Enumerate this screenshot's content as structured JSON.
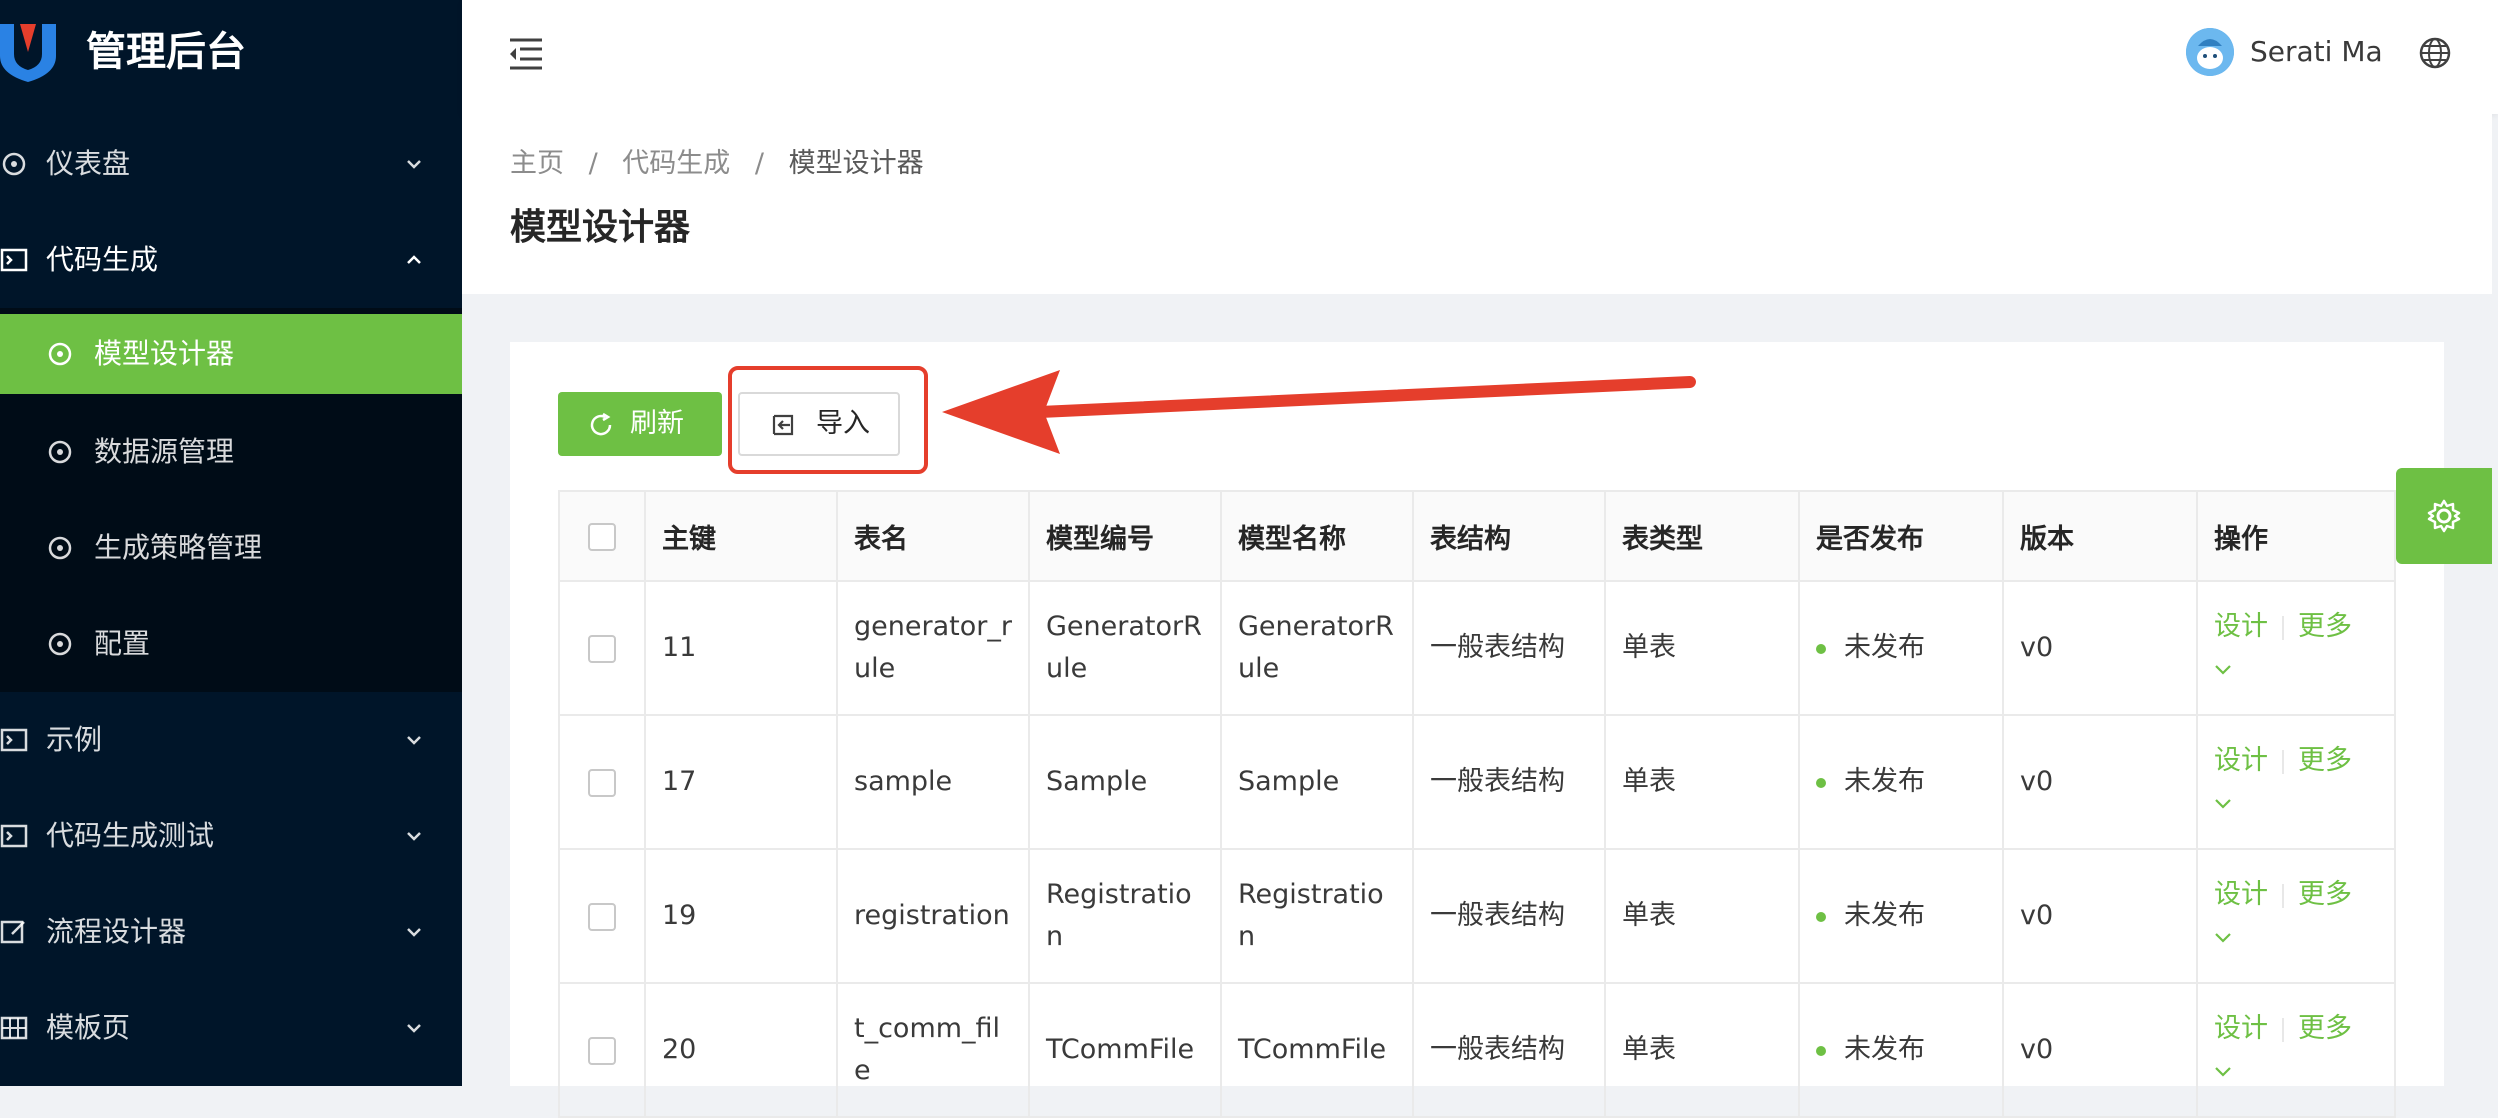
{
  "app": {
    "title": "管理后台"
  },
  "sidebar": {
    "items": [
      {
        "label": "仪表盘"
      },
      {
        "label": "代码生成"
      },
      {
        "label": "示例"
      },
      {
        "label": "代码生成测试"
      },
      {
        "label": "流程设计器"
      },
      {
        "label": "模板页"
      }
    ],
    "submenu": [
      {
        "label": "模型设计器",
        "active": true
      },
      {
        "label": "数据源管理"
      },
      {
        "label": "生成策略管理"
      },
      {
        "label": "配置"
      }
    ]
  },
  "header": {
    "username": "Serati Ma"
  },
  "breadcrumb": {
    "home": "主页",
    "parent": "代码生成",
    "current": "模型设计器",
    "separator": "/"
  },
  "page": {
    "title": "模型设计器"
  },
  "toolbar": {
    "refresh_label": "刷新",
    "import_label": "导入"
  },
  "table": {
    "columns": [
      "主键",
      "表名",
      "模型编号",
      "模型名称",
      "表结构",
      "表类型",
      "是否发布",
      "版本",
      "操作"
    ],
    "rows": [
      {
        "id": "11",
        "table_name": "generator_rule",
        "model_code": "GeneratorRule",
        "model_name": "GeneratorRule",
        "structure": "一般表结构",
        "type": "单表",
        "status": "未发布",
        "version": "v0"
      },
      {
        "id": "17",
        "table_name": "sample",
        "model_code": "Sample",
        "model_name": "Sample",
        "structure": "一般表结构",
        "type": "单表",
        "status": "未发布",
        "version": "v0"
      },
      {
        "id": "19",
        "table_name": "registration",
        "model_code": "Registration",
        "model_name": "Registration",
        "structure": "一般表结构",
        "type": "单表",
        "status": "未发布",
        "version": "v0"
      },
      {
        "id": "20",
        "table_name": "t_comm_file",
        "model_code": "TCommFile",
        "model_name": "TCommFile",
        "structure": "一般表结构",
        "type": "单表",
        "status": "未发布",
        "version": "v0"
      }
    ],
    "actions": {
      "design": "设计",
      "more": "更多"
    }
  },
  "colors": {
    "primary": "#6ec044",
    "sidebar_bg": "#001529",
    "annotation": "#e53e2c"
  }
}
